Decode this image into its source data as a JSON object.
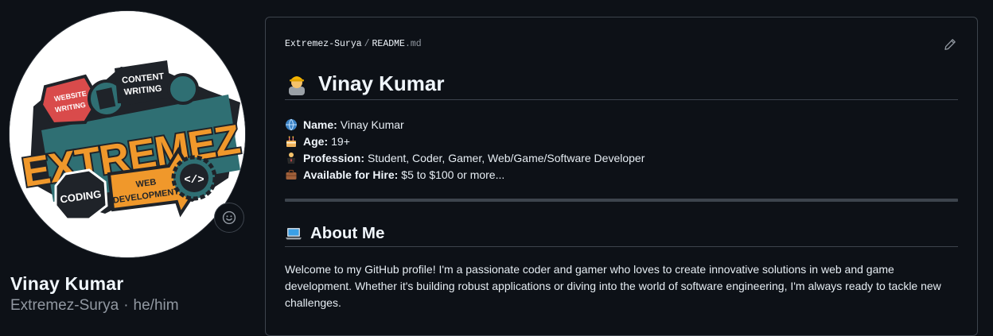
{
  "profile": {
    "name": "Vinay Kumar",
    "username": "Extremez-Surya",
    "separator": "·",
    "pronouns": "he/him",
    "avatar_texts": {
      "website_writing": "WEBSITE WRITING",
      "content_writing": "CONTENT WRITING",
      "brand": "EXTREMEZ",
      "coding": "CODING",
      "web_development": "WEB DEVELOPMENT",
      "code_symbol": "</>"
    }
  },
  "readme": {
    "breadcrumb": {
      "owner": "Extremez-Surya",
      "slash": "/",
      "file": "README",
      "ext": ".md"
    },
    "heading": "Vinay Kumar",
    "facts": [
      {
        "icon": "globe-icon",
        "label": "Name:",
        "value": "Vinay Kumar"
      },
      {
        "icon": "birthday-cake-icon",
        "label": "Age:",
        "value": "19+"
      },
      {
        "icon": "person-at-desk-icon",
        "label": "Profession:",
        "value": "Student, Coder, Gamer, Web/Game/Software Developer"
      },
      {
        "icon": "briefcase-icon",
        "label": "Available for Hire:",
        "value": "$5 to $100 or more..."
      }
    ],
    "about_heading": "About Me",
    "about_text": "Welcome to my GitHub profile! I'm a passionate coder and gamer who loves to create innovative solutions in web and game development. Whether it's building robust applications or diving into the world of software engineering, I'm always ready to tackle new challenges."
  },
  "colors": {
    "background": "#0d1117",
    "border": "#3d444d",
    "text": "#e6edf3",
    "muted": "#9198a1",
    "logo_orange": "#f0982b",
    "logo_teal": "#2f6f73",
    "logo_red": "#d94b4b"
  }
}
